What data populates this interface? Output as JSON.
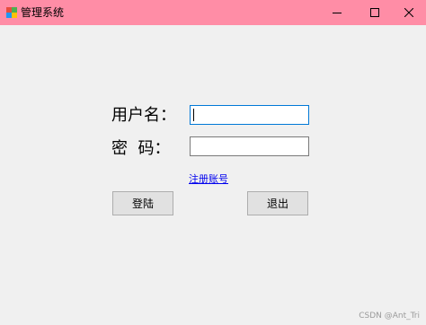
{
  "window": {
    "title": "管理系统",
    "app_icon": "app-icon",
    "titlebar_color": "#ff8da6",
    "controls": {
      "minimize_icon": "minimize-icon",
      "maximize_icon": "maximize-icon",
      "close_icon": "close-icon"
    }
  },
  "form": {
    "username_label": "用户名：",
    "password_label": "密  码：",
    "username_value": "",
    "password_value": "",
    "register_link": "注册账号",
    "login_button": "登陆",
    "exit_button": "退出"
  },
  "watermark": "CSDN @Ant_Tri"
}
